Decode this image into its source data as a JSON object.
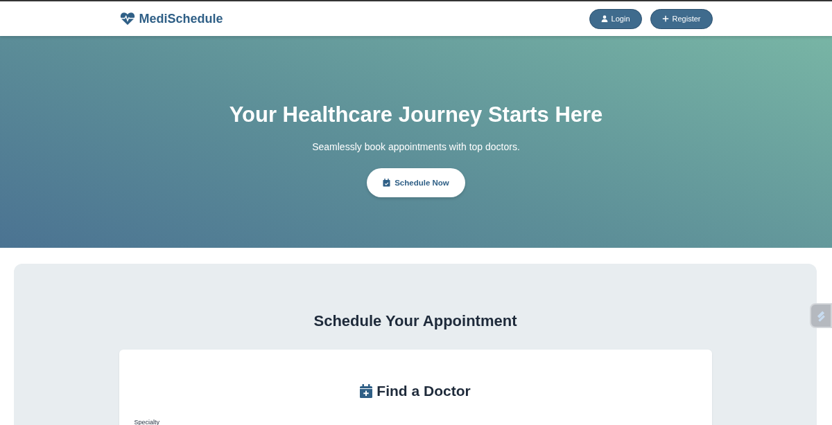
{
  "navbar": {
    "brand": "MediSchedule",
    "buttons": [
      {
        "kind": "login",
        "label": "Login"
      },
      {
        "kind": "register",
        "label": "Register"
      }
    ]
  },
  "hero": {
    "title": "Your Healthcare Journey Starts Here",
    "subtitle": "Seamlessly book appointments with top doctors.",
    "button": "Schedule Now"
  },
  "appointment": {
    "title": "Schedule Your Appointment",
    "card_title": "Find a Doctor",
    "fields": [
      {
        "label": "Specialty"
      }
    ]
  }
}
